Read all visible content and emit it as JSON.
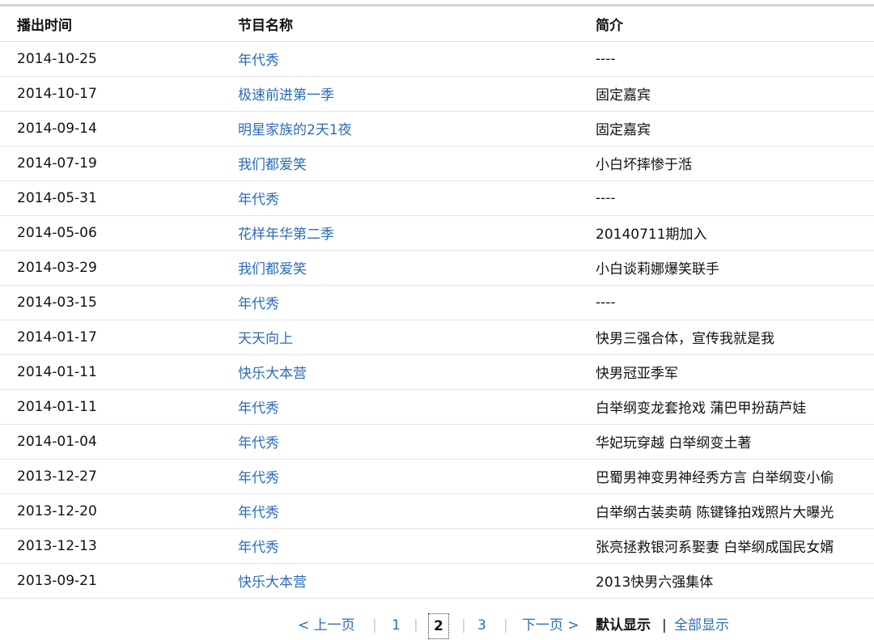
{
  "table": {
    "headers": {
      "date": "播出时间",
      "program": "节目名称",
      "desc": "简介"
    },
    "rows": [
      {
        "date": "2014-10-25",
        "program": "年代秀",
        "desc": "----"
      },
      {
        "date": "2014-10-17",
        "program": "极速前进第一季",
        "desc": "固定嘉宾"
      },
      {
        "date": "2014-09-14",
        "program": "明星家族的2天1夜",
        "desc": "固定嘉宾"
      },
      {
        "date": "2014-07-19",
        "program": "我们都爱笑",
        "desc": "小白坏摔惨于湉"
      },
      {
        "date": "2014-05-31",
        "program": "年代秀",
        "desc": "----"
      },
      {
        "date": "2014-05-06",
        "program": "花样年华第二季",
        "desc": "20140711期加入"
      },
      {
        "date": "2014-03-29",
        "program": "我们都爱笑",
        "desc": "小白谈莉娜爆笑联手"
      },
      {
        "date": "2014-03-15",
        "program": "年代秀",
        "desc": "----"
      },
      {
        "date": "2014-01-17",
        "program": "天天向上",
        "desc": "快男三强合体，宣传我就是我"
      },
      {
        "date": "2014-01-11",
        "program": "快乐大本营",
        "desc": "快男冠亚季军"
      },
      {
        "date": "2014-01-11",
        "program": "年代秀",
        "desc": "白举纲变龙套抢戏 蒲巴甲扮葫芦娃"
      },
      {
        "date": "2014-01-04",
        "program": "年代秀",
        "desc": "华妃玩穿越 白举纲变土著"
      },
      {
        "date": "2013-12-27",
        "program": "年代秀",
        "desc": "巴蜀男神变男神经秀方言 白举纲变小偷"
      },
      {
        "date": "2013-12-20",
        "program": "年代秀",
        "desc": "白举纲古装卖萌 陈键锋拍戏照片大曝光"
      },
      {
        "date": "2013-12-13",
        "program": "年代秀",
        "desc": "张亮拯救银河系娶妻 白举纲成国民女婿"
      },
      {
        "date": "2013-09-21",
        "program": "快乐大本营",
        "desc": "2013快男六强集体"
      }
    ]
  },
  "pager": {
    "prev": "< 上一页",
    "sep": "|",
    "pages": [
      "1",
      "2",
      "3"
    ],
    "current": "2",
    "next": "下一页 >",
    "default_view": "默认显示",
    "bar": "|",
    "all_view": "全部显示"
  },
  "colors": {
    "link": "#2b6cb8",
    "text": "#111111",
    "separator": "#c8c8c8"
  }
}
